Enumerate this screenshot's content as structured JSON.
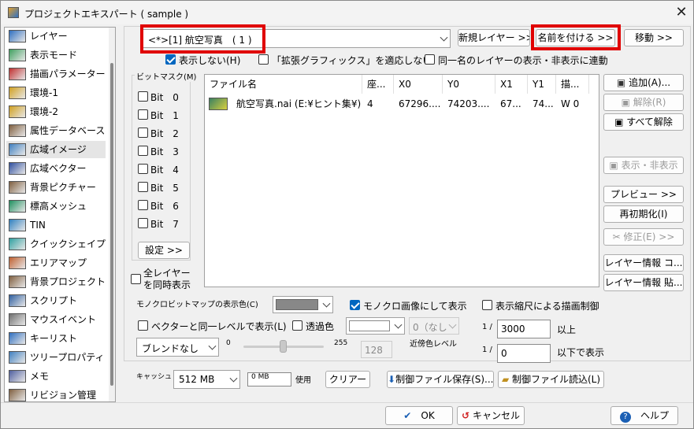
{
  "window": {
    "title": "プロジェクトエキスパート ( sample )",
    "close_glyph": "✕"
  },
  "sidebar": {
    "items": [
      {
        "label": "レイヤー",
        "icon": "layer-icon"
      },
      {
        "label": "表示モード",
        "icon": "display-mode-icon"
      },
      {
        "label": "描画パラメーター",
        "icon": "draw-params-icon"
      },
      {
        "label": "環境-1",
        "icon": "environment-icon"
      },
      {
        "label": "環境-2",
        "icon": "environment-icon"
      },
      {
        "label": "属性データベース",
        "icon": "database-icon"
      },
      {
        "label": "広域イメージ",
        "icon": "wide-image-icon"
      },
      {
        "label": "広域ベクター",
        "icon": "wide-vector-icon"
      },
      {
        "label": "背景ピクチャー",
        "icon": "background-picture-icon"
      },
      {
        "label": "標高メッシュ",
        "icon": "elevation-mesh-icon"
      },
      {
        "label": "TIN",
        "icon": "tin-icon"
      },
      {
        "label": "クイックシェイプ",
        "icon": "quick-shape-icon"
      },
      {
        "label": "エリアマップ",
        "icon": "area-map-icon"
      },
      {
        "label": "背景プロジェクト",
        "icon": "background-project-icon"
      },
      {
        "label": "スクリプト",
        "icon": "script-icon"
      },
      {
        "label": "マウスイベント",
        "icon": "mouse-icon"
      },
      {
        "label": "キーリスト",
        "icon": "key-list-icon"
      },
      {
        "label": "ツリープロパティ",
        "icon": "tree-property-icon"
      },
      {
        "label": "メモ",
        "icon": "memo-icon"
      },
      {
        "label": "リビジョン管理",
        "icon": "revision-icon"
      }
    ],
    "selected_index": 6
  },
  "layer_select": {
    "value": "<*>[1] 航空写真　( 1 )"
  },
  "buttons": {
    "new_layer": "新規レイヤー >>",
    "rename": "名前を付ける >>",
    "move": "移動 >>",
    "add": "追加(A)...",
    "remove": "解除(R)",
    "remove_all": "すべて解除",
    "show_hide": "表示・非表示",
    "preview": "プレビュー >>",
    "reinit": "再初期化(I)",
    "modify": "修正(E) >>",
    "layer_info_copy": "レイヤー情報 コ...",
    "layer_info_paste": "レイヤー情報 貼...",
    "settings": "設定 >>",
    "clear": "クリアー",
    "save_ctrl": "制御ファイル保存(S)...",
    "load_ctrl": "制御ファイル読込(L)",
    "ok": "OK",
    "cancel": "キャンセル",
    "help": "ヘルプ"
  },
  "options": {
    "hide": "表示しない(H)",
    "hide_checked": true,
    "apply_ext": "「拡張グラフィックス」を適応しない",
    "apply_ext_checked": false,
    "same_name": "同一名のレイヤーの表示・非表示に連動",
    "same_name_checked": false
  },
  "bitmask": {
    "title": "ビットマスク(M)",
    "bits": [
      "Bit　0",
      "Bit　1",
      "Bit　2",
      "Bit　3",
      "Bit　4",
      "Bit　5",
      "Bit　6",
      "Bit　7"
    ]
  },
  "all_layers": "全レイヤーを同時表示",
  "table": {
    "headers": [
      "ファイル名",
      "座...",
      "X0",
      "Y0",
      "X1",
      "Y1",
      "描..."
    ],
    "rows": [
      [
        "航空写真.nai (E:¥ヒント集¥)",
        "4",
        "67296....",
        "74203....",
        "67...",
        "74...",
        "W 0"
      ]
    ]
  },
  "mono": {
    "color_label": "モノクロビットマップの表示色(C)",
    "mono_image": "モノクロ画像にして表示",
    "mono_image_checked": true,
    "scale_ctrl": "表示縮尺による描画制御",
    "scale_ctrl_checked": false
  },
  "vector": {
    "same_level": "ベクターと同一レベルで表示(L)",
    "transparent": "透過色",
    "near_value": "0（なし",
    "near_label": "近傍色レベル"
  },
  "blend": {
    "value": "ブレンドなし",
    "min": "0",
    "max": "255",
    "value_num": "128",
    "slider": 0.5
  },
  "scale": {
    "prefix1": "1 /",
    "upper": "3000",
    "upper_label": "以上",
    "prefix2": "1 /",
    "lower": "0",
    "lower_label": "以下で表示"
  },
  "cache": {
    "label": "キャッシュ",
    "value": "512 MB",
    "used": "0 MB",
    "used_label": "使用"
  }
}
